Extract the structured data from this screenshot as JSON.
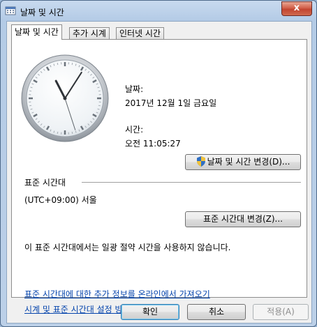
{
  "window": {
    "title": "날짜 및 시간",
    "close_glyph": "x"
  },
  "tabs": [
    {
      "label": "날짜 및 시간",
      "active": true
    },
    {
      "label": "추가 시계",
      "active": false
    },
    {
      "label": "인터넷 시간",
      "active": false
    }
  ],
  "date_section": {
    "date_label": "날짜:",
    "date_value": "2017년 12월 1일 금요일"
  },
  "time_section": {
    "time_label": "시간:",
    "time_value": "오전 11:05:27"
  },
  "change_datetime_button": "날짜 및 시간 변경(D)...",
  "timezone": {
    "heading": "표준 시간대",
    "value": "(UTC+09:00) 서울",
    "change_button": "표준 시간대 변경(Z)...",
    "dst_note": "이 표준 시간대에서는 일광 절약 시간을 사용하지 않습니다."
  },
  "links": {
    "more_info": "표준 시간대에 대한 추가 정보를 온라인에서 가져오기",
    "how_to": "시계 및 표준 시간대 설정 방법"
  },
  "buttons": {
    "ok": "확인",
    "cancel": "취소",
    "apply": "적용(A)"
  },
  "icons": {
    "title": "calendar-clock-icon",
    "shield": "uac-shield-icon",
    "close": "close-icon"
  },
  "clock": {
    "hour": 11,
    "minute": 5,
    "second": 27
  },
  "colors": {
    "link": "#0645ad",
    "close_button": "#c24530"
  }
}
